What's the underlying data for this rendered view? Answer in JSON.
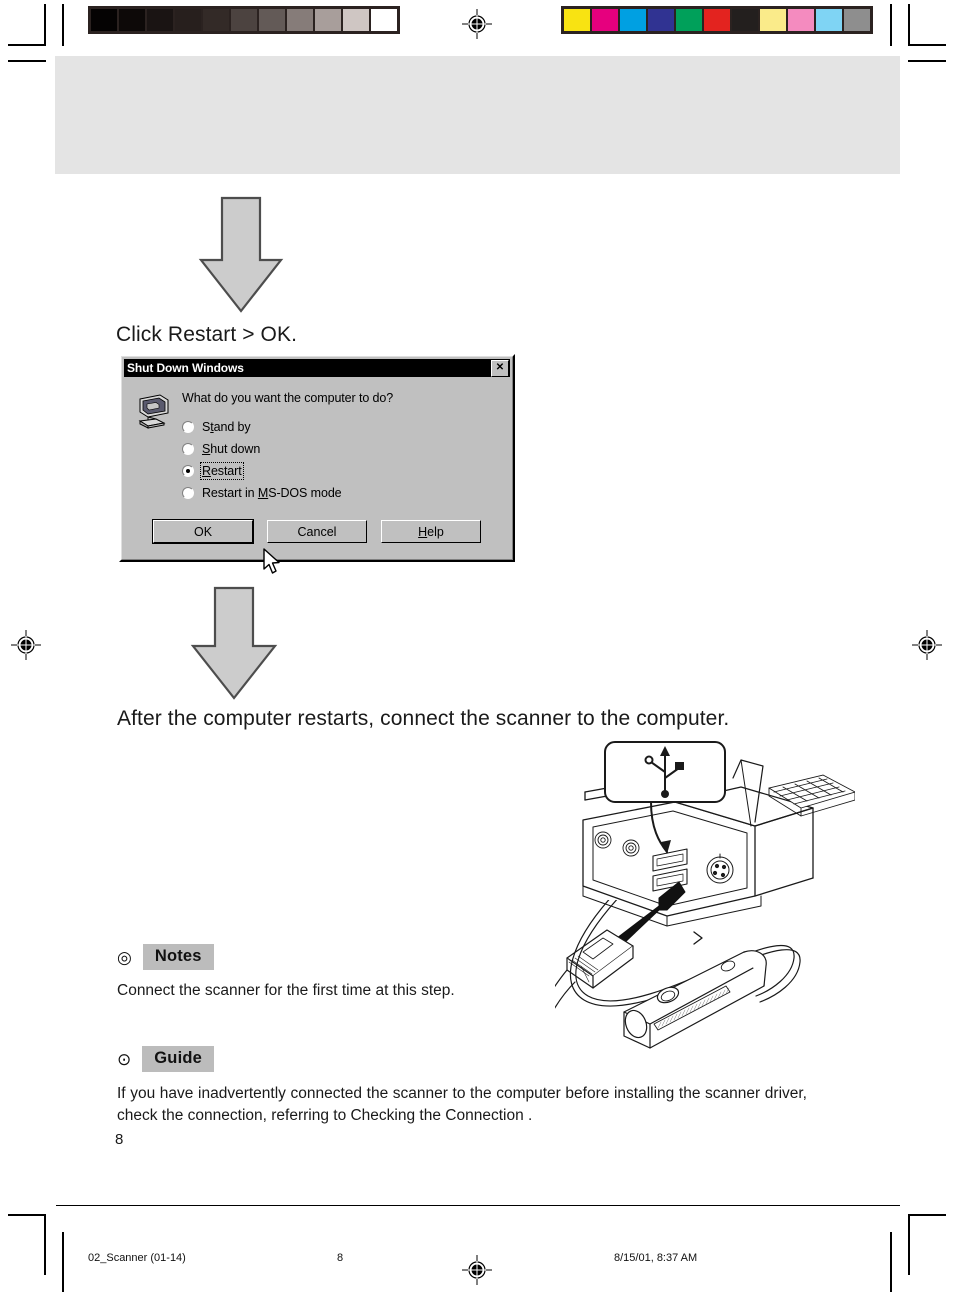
{
  "document": {
    "page_number": "8",
    "header_band": {
      "label": ""
    }
  },
  "calibration": {
    "gray_strip": {
      "name": "grayscale-calibration-strip",
      "swatches": [
        "#050303",
        "#0d0908",
        "#1a1413",
        "#271f1d",
        "#332a27",
        "#4c4340",
        "#635a57",
        "#867c79",
        "#a89e9b",
        "#cfc6c3",
        "#ffffff"
      ]
    },
    "color_strip": {
      "name": "color-calibration-strip",
      "swatches": [
        "#f8e312",
        "#e6007e",
        "#00a0e2",
        "#303392",
        "#00a05a",
        "#e3231f",
        "#231f1e",
        "#faeb8a",
        "#f48bbf",
        "#7fd4f4",
        "#8e8e8e"
      ]
    }
  },
  "steps": [
    {
      "id": "step-1",
      "heading": "Click Restart > OK.",
      "arrow_above": "down-arrow"
    },
    {
      "id": "step-2",
      "heading": "After the computer restarts, connect the scanner to the computer.",
      "arrow_above": "down-arrow"
    }
  ],
  "dialog": {
    "title": "Shut Down Windows",
    "close_label": "✕",
    "icon": "shutdown-computer-icon",
    "question": "What do you want the computer to do?",
    "options": [
      {
        "label": "Stand by",
        "accel": "t",
        "checked": false,
        "focused": false
      },
      {
        "label": "Shut down",
        "accel": "S",
        "checked": false,
        "focused": false
      },
      {
        "label": "Restart",
        "accel": "R",
        "checked": true,
        "focused": true
      },
      {
        "label": "Restart in MS-DOS mode",
        "accel": "M",
        "checked": false,
        "focused": false
      }
    ],
    "buttons": [
      {
        "label": "OK",
        "accel": "",
        "default": true
      },
      {
        "label": "Cancel",
        "accel": "",
        "default": false
      },
      {
        "label": "Help",
        "accel": "H",
        "default": false
      }
    ],
    "cursor": "mouse-pointer"
  },
  "illustration": {
    "name": "usb-connection-illustration",
    "callout_icon": "usb-symbol-icon",
    "parts": [
      "computer-rear-panel",
      "usb-ports",
      "usb-plug",
      "arrow-insert",
      "scanner-device",
      "scanner-cable"
    ]
  },
  "notes": {
    "bullet": "◎",
    "tag": "Notes",
    "body": "Connect the scanner for the first time at this step."
  },
  "guide": {
    "bullet": "⊙",
    "tag": "Guide",
    "body": "If you have inadvertently connected the scanner to the computer before installing the scanner driver, check the connection, referring to  Checking the Connection ."
  },
  "footer": {
    "file": "02_Scanner (01-14)",
    "page": "8",
    "date": "8/15/01, 8:37 AM"
  },
  "colors": {
    "arrow_fill": "#cccccc",
    "arrow_stroke": "#4d4d4d",
    "band": "#e4e4e4",
    "tag_bg": "#bcbcbc",
    "dialog_face": "#c0c0c0"
  }
}
